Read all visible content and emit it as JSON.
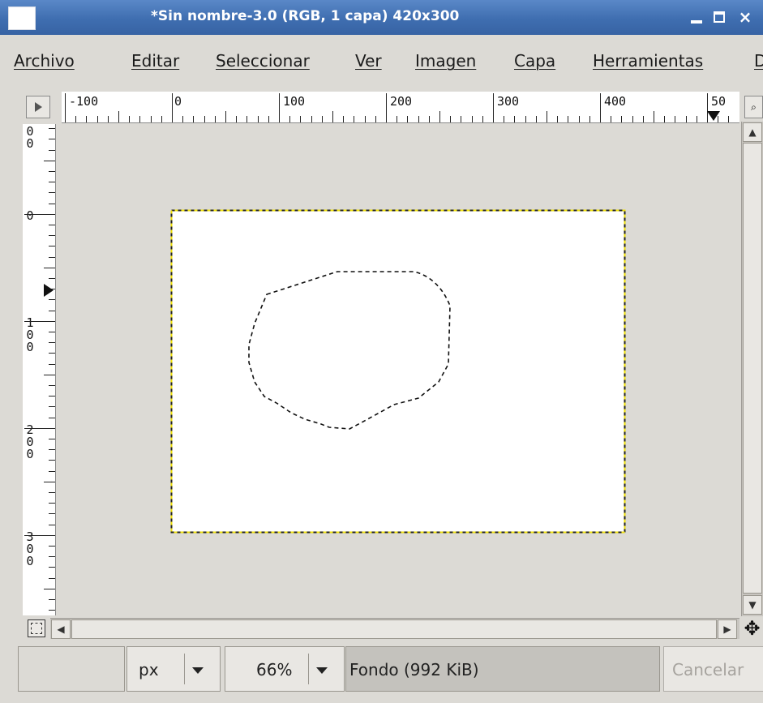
{
  "window": {
    "title": "*Sin nombre-3.0 (RGB, 1 capa) 420x300",
    "controls": {
      "minimize": "minimize",
      "maximize": "maximize",
      "close": "×"
    }
  },
  "menubar": {
    "items": [
      "Archivo",
      "Editar",
      "Seleccionar",
      "Ver",
      "Imagen",
      "Capa",
      "Herramientas",
      "D"
    ]
  },
  "rulers": {
    "horizontal_labels": [
      "-100",
      "0",
      "100",
      "200",
      "300",
      "400",
      "50"
    ],
    "vertical_labels": [
      "0\n0",
      "0",
      "1\n0\n0",
      "2\n0\n0",
      "3\n0\n0"
    ]
  },
  "canvas": {
    "image_size": "420x300",
    "selection": "free-form-marching-ants",
    "image_border_colors": {
      "dash_a": "#f1e20b",
      "dash_b": "#222222"
    }
  },
  "statusbar": {
    "unit": "px",
    "zoom": "66%",
    "message": "Fondo (992 KiB)",
    "cancel_label": "Cancelar"
  },
  "colors": {
    "titlebar": "#4574b8",
    "background": "#dcdad5",
    "canvas": "#ffffff"
  }
}
